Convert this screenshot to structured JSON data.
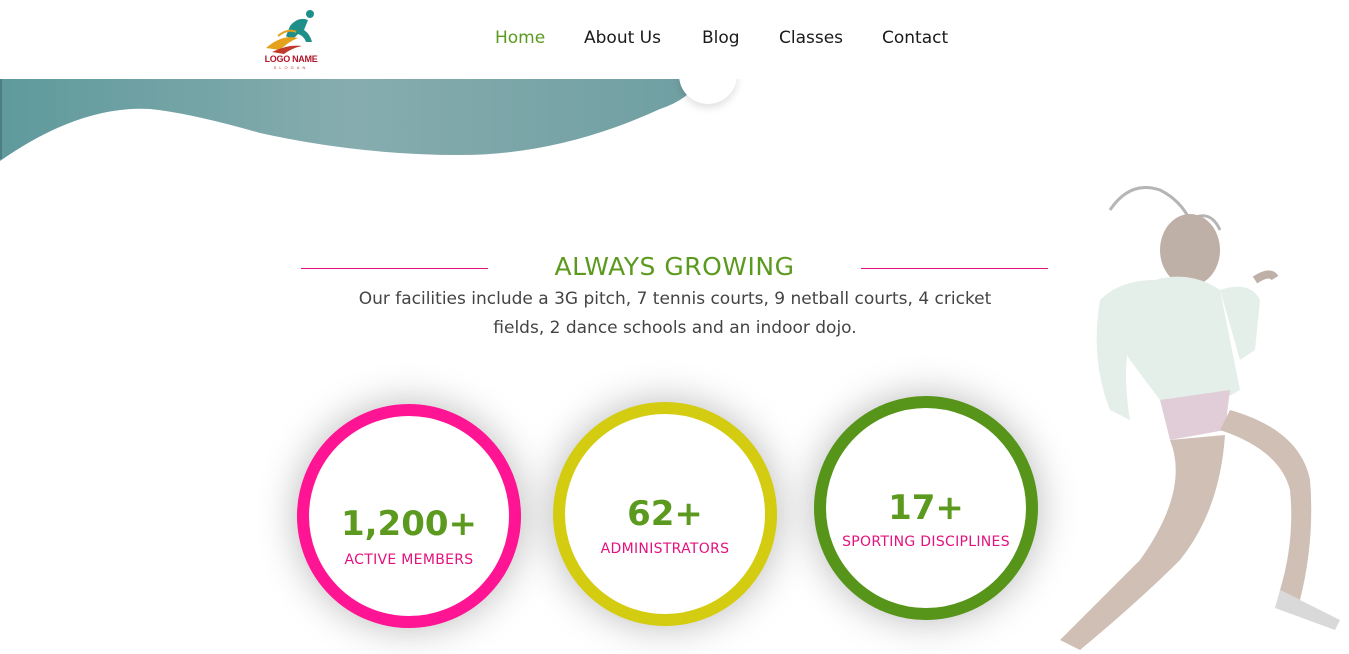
{
  "header": {
    "logo_text": "LOGO NAME",
    "logo_subtext": "SLOGAN",
    "nav": [
      {
        "label": "Home",
        "active": true
      },
      {
        "label": "About Us",
        "active": false
      },
      {
        "label": "Blog",
        "active": false
      },
      {
        "label": "Classes",
        "active": false
      },
      {
        "label": "Contact",
        "active": false
      }
    ]
  },
  "section": {
    "title": "ALWAYS GROWING",
    "description_line1": "Our facilities include a 3G pitch, 7 tennis courts, 9 netball courts, 4 cricket",
    "description_line2": "fields, 2 dance schools and an indoor dojo."
  },
  "stats": [
    {
      "value": "1,200+",
      "label": "ACTIVE MEMBERS",
      "ring_color": "#ff1493"
    },
    {
      "value": "62+",
      "label": "ADMINISTRATORS",
      "ring_color": "#d4cc10"
    },
    {
      "value": "17+",
      "label": "SPORTING DISCIPLINES",
      "ring_color": "#57951a"
    }
  ],
  "colors": {
    "accent_green": "#5b9a1f",
    "accent_pink": "#e3127d",
    "hero_teal": "#7fa9ab"
  },
  "icons": {
    "logo": "athlete-logo-icon",
    "runner": "runner-image"
  }
}
